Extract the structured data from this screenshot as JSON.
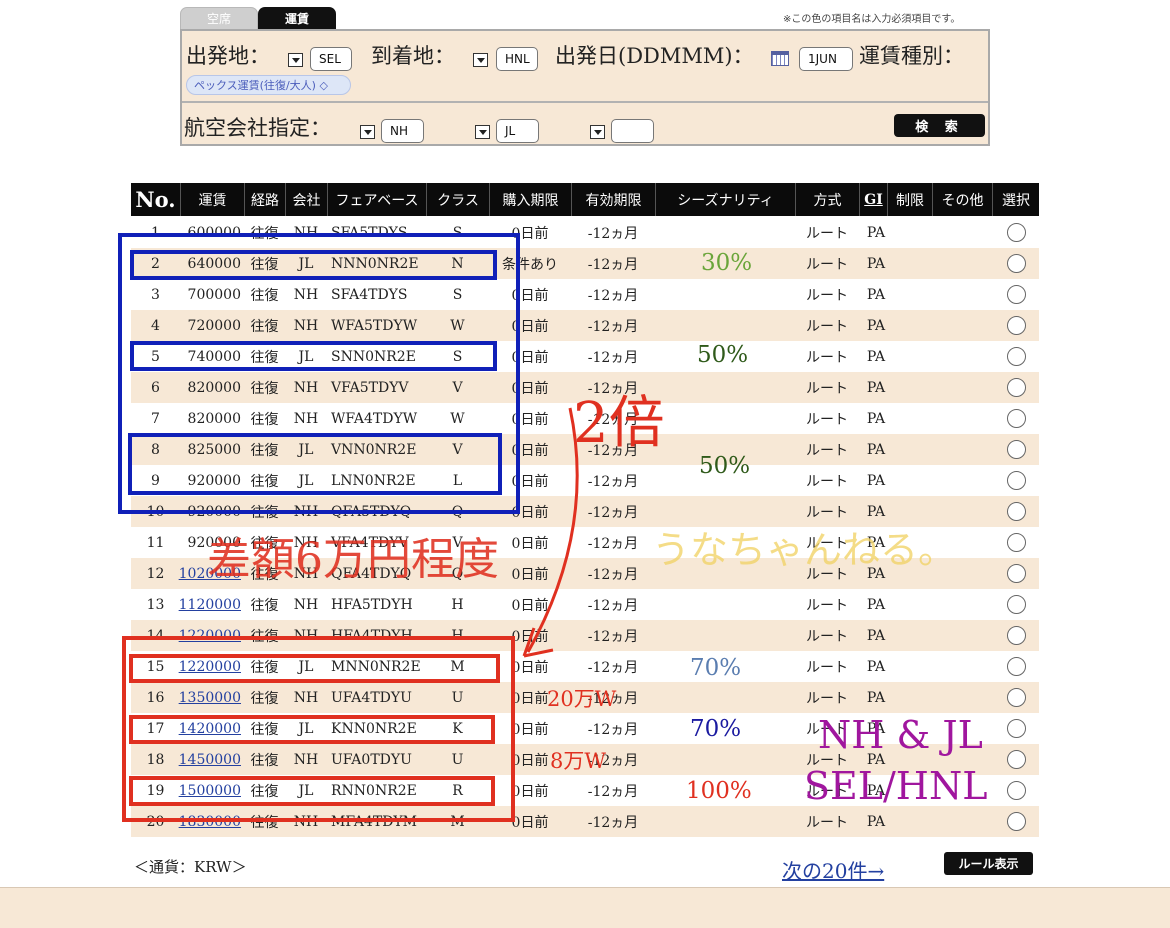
{
  "tabs": [
    {
      "label": "空席"
    },
    {
      "label": "運賃"
    }
  ],
  "required_note": "※この色の項目名は入力必須項目です。",
  "search": {
    "origin_label": "出発地：",
    "origin_value": "SEL",
    "destination_label": "到着地：",
    "destination_value": "HNL",
    "date_label": "出発日(DDMMM)：",
    "date_value": "1JUN",
    "fare_type_label": "運賃種別：",
    "fare_type_value": "ペックス運賃(往復/大人) ◇",
    "airline_label": "航空会社指定：",
    "airline_1": "NH",
    "airline_2": "JL",
    "airline_3": "",
    "search_button": "検 索"
  },
  "table": {
    "headers": [
      "No.",
      "運賃",
      "経路",
      "会社",
      "フェアベース",
      "クラス",
      "購入期限",
      "有効期限",
      "シーズナリティ",
      "方式",
      "GI",
      "制限",
      "その他",
      "選択"
    ],
    "rows": [
      {
        "no": "1",
        "fare": "600000",
        "route": "往復",
        "airline": "NH",
        "farebase": "SFA5TDYS",
        "class": "S",
        "purchase": "0日前",
        "validity": "-12ヵ月",
        "method": "ルート",
        "gi": "PA",
        "link": false
      },
      {
        "no": "2",
        "fare": "640000",
        "route": "往復",
        "airline": "JL",
        "farebase": "NNN0NR2E",
        "class": "N",
        "purchase": "条件あり",
        "validity": "-12ヵ月",
        "method": "ルート",
        "gi": "PA",
        "link": false
      },
      {
        "no": "3",
        "fare": "700000",
        "route": "往復",
        "airline": "NH",
        "farebase": "SFA4TDYS",
        "class": "S",
        "purchase": "0日前",
        "validity": "-12ヵ月",
        "method": "ルート",
        "gi": "PA",
        "link": false
      },
      {
        "no": "4",
        "fare": "720000",
        "route": "往復",
        "airline": "NH",
        "farebase": "WFA5TDYW",
        "class": "W",
        "purchase": "0日前",
        "validity": "-12ヵ月",
        "method": "ルート",
        "gi": "PA",
        "link": false
      },
      {
        "no": "5",
        "fare": "740000",
        "route": "往復",
        "airline": "JL",
        "farebase": "SNN0NR2E",
        "class": "S",
        "purchase": "0日前",
        "validity": "-12ヵ月",
        "method": "ルート",
        "gi": "PA",
        "link": false
      },
      {
        "no": "6",
        "fare": "820000",
        "route": "往復",
        "airline": "NH",
        "farebase": "VFA5TDYV",
        "class": "V",
        "purchase": "0日前",
        "validity": "-12ヵ月",
        "method": "ルート",
        "gi": "PA",
        "link": false
      },
      {
        "no": "7",
        "fare": "820000",
        "route": "往復",
        "airline": "NH",
        "farebase": "WFA4TDYW",
        "class": "W",
        "purchase": "0日前",
        "validity": "-12ヵ月",
        "method": "ルート",
        "gi": "PA",
        "link": false
      },
      {
        "no": "8",
        "fare": "825000",
        "route": "往復",
        "airline": "JL",
        "farebase": "VNN0NR2E",
        "class": "V",
        "purchase": "0日前",
        "validity": "-12ヵ月",
        "method": "ルート",
        "gi": "PA",
        "link": false
      },
      {
        "no": "9",
        "fare": "920000",
        "route": "往復",
        "airline": "JL",
        "farebase": "LNN0NR2E",
        "class": "L",
        "purchase": "0日前",
        "validity": "-12ヵ月",
        "method": "ルート",
        "gi": "PA",
        "link": false
      },
      {
        "no": "10",
        "fare": "920000",
        "route": "往復",
        "airline": "NH",
        "farebase": "QFA5TDYQ",
        "class": "Q",
        "purchase": "0日前",
        "validity": "-12ヵ月",
        "method": "ルート",
        "gi": "PA",
        "link": false
      },
      {
        "no": "11",
        "fare": "920000",
        "route": "往復",
        "airline": "NH",
        "farebase": "VFA4TDYV",
        "class": "V",
        "purchase": "0日前",
        "validity": "-12ヵ月",
        "method": "ルート",
        "gi": "PA",
        "link": false
      },
      {
        "no": "12",
        "fare": "1020000",
        "route": "往復",
        "airline": "NH",
        "farebase": "QFA4TDYQ",
        "class": "Q",
        "purchase": "0日前",
        "validity": "-12ヵ月",
        "method": "ルート",
        "gi": "PA",
        "link": true
      },
      {
        "no": "13",
        "fare": "1120000",
        "route": "往復",
        "airline": "NH",
        "farebase": "HFA5TDYH",
        "class": "H",
        "purchase": "0日前",
        "validity": "-12ヵ月",
        "method": "ルート",
        "gi": "PA",
        "link": true
      },
      {
        "no": "14",
        "fare": "1220000",
        "route": "往復",
        "airline": "NH",
        "farebase": "HFA4TDYH",
        "class": "H",
        "purchase": "0日前",
        "validity": "-12ヵ月",
        "method": "ルート",
        "gi": "PA",
        "link": true
      },
      {
        "no": "15",
        "fare": "1220000",
        "route": "往復",
        "airline": "JL",
        "farebase": "MNN0NR2E",
        "class": "M",
        "purchase": "0日前",
        "validity": "-12ヵ月",
        "method": "ルート",
        "gi": "PA",
        "link": true
      },
      {
        "no": "16",
        "fare": "1350000",
        "route": "往復",
        "airline": "NH",
        "farebase": "UFA4TDYU",
        "class": "U",
        "purchase": "0日前",
        "validity": "-12ヵ月",
        "method": "ルート",
        "gi": "PA",
        "link": true
      },
      {
        "no": "17",
        "fare": "1420000",
        "route": "往復",
        "airline": "JL",
        "farebase": "KNN0NR2E",
        "class": "K",
        "purchase": "0日前",
        "validity": "-12ヵ月",
        "method": "ルート",
        "gi": "PA",
        "link": true
      },
      {
        "no": "18",
        "fare": "1450000",
        "route": "往復",
        "airline": "NH",
        "farebase": "UFA0TDYU",
        "class": "U",
        "purchase": "0日前",
        "validity": "-12ヵ月",
        "method": "ルート",
        "gi": "PA",
        "link": true
      },
      {
        "no": "19",
        "fare": "1500000",
        "route": "往復",
        "airline": "JL",
        "farebase": "RNN0NR2E",
        "class": "R",
        "purchase": "0日前",
        "validity": "-12ヵ月",
        "method": "ルート",
        "gi": "PA",
        "link": true
      },
      {
        "no": "20",
        "fare": "1830000",
        "route": "往復",
        "airline": "NH",
        "farebase": "MFA4TDYM",
        "class": "M",
        "purchase": "0日前",
        "validity": "-12ヵ月",
        "method": "ルート",
        "gi": "PA",
        "link": true
      }
    ]
  },
  "footer": {
    "currency": "＜通貨：KRW＞",
    "next_page": "次の20件→",
    "rule_button": "ルール表示"
  },
  "annotations": {
    "pct_30": "30%",
    "pct_50_a": "50%",
    "pct_50_b": "50%",
    "pct_70_a": "70%",
    "pct_70_b": "70%",
    "pct_100": "100%",
    "double": "2倍",
    "diff": "差額6万円程度",
    "watermark": "うなちゃんねる。",
    "won_20": "20万W",
    "won_8": "8万W",
    "route_line1": "NH & JL",
    "route_line2": "SEL/HNL"
  },
  "colors": {
    "header_bg": "#0b0b0b",
    "panel_bg": "#f7e8d6",
    "row_alt": "#f7e8d6",
    "link": "#2340a0",
    "box_blue": "#1020b8",
    "box_red": "#e03020",
    "pct_green": "#6aa53a",
    "pct_darkgreen": "#2f5a1a",
    "pct_steel": "#5a7db0",
    "pct_navy": "#1a1aa0",
    "watermark_yellow": "#f2d46a",
    "purple": "#a0169e"
  }
}
